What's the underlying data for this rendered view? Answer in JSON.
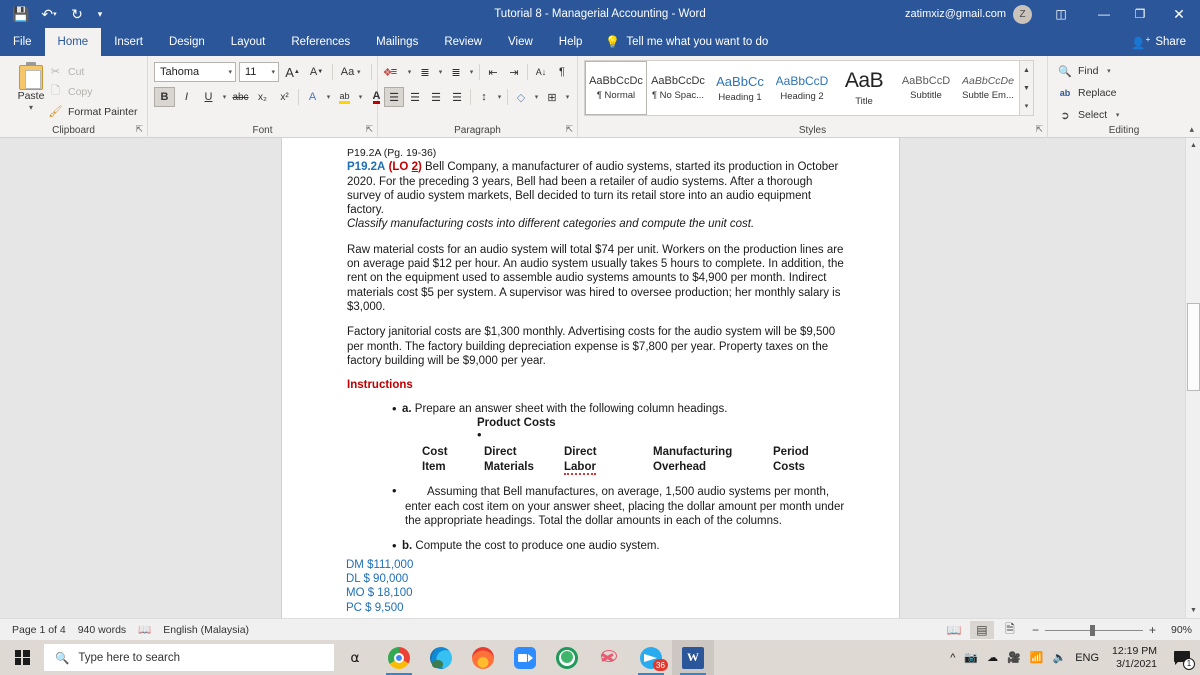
{
  "titlebar": {
    "document_title": "Tutorial 8 - Managerial Accounting  -  Word",
    "account_email": "zatimxiz@gmail.com",
    "avatar_initial": "Z",
    "quick_access": [
      {
        "name": "save",
        "glyph": "ὋE"
      },
      {
        "name": "undo",
        "glyph": "↶"
      },
      {
        "name": "redo",
        "glyph": "↻"
      },
      {
        "name": "customize",
        "glyph": "≡"
      }
    ],
    "ribbon_display_options": "☷",
    "minimize": "—",
    "restore": "❐",
    "close": "✕"
  },
  "tabs": [
    {
      "label": "File",
      "active": false
    },
    {
      "label": "Home",
      "active": true
    },
    {
      "label": "Insert",
      "active": false
    },
    {
      "label": "Design",
      "active": false
    },
    {
      "label": "Layout",
      "active": false
    },
    {
      "label": "References",
      "active": false
    },
    {
      "label": "Mailings",
      "active": false
    },
    {
      "label": "Review",
      "active": false
    },
    {
      "label": "View",
      "active": false
    },
    {
      "label": "Help",
      "active": false
    }
  ],
  "tellme": {
    "label": "Tell me what you want to do",
    "icon": "Ὂ1"
  },
  "share": {
    "label": "Share"
  },
  "ribbon": {
    "clipboard": {
      "group_label": "Clipboard",
      "paste_label": "Paste",
      "cut_label": "Cut",
      "copy_label": "Copy",
      "format_painter_label": "Format Painter"
    },
    "font": {
      "group_label": "Font",
      "font_name": "Tahoma",
      "font_size": "11",
      "grow_font": "A",
      "shrink_font": "A",
      "change_case": "Aa",
      "clear_formatting": "✐",
      "bold": "B",
      "italic": "I",
      "underline": "U",
      "strikethrough": "abc",
      "subscript": "x₂",
      "superscript": "x²",
      "text_effects": "A",
      "highlight": "ab",
      "font_color": "A"
    },
    "paragraph": {
      "group_label": "Paragraph",
      "bullets": "☰",
      "numbering": "☰",
      "multilevel": "☰",
      "decrease_indent": "⇤",
      "increase_indent": "⇥",
      "sort": "A↓",
      "show_marks": "¶",
      "align_left": "☰",
      "align_center": "☰",
      "align_right": "☰",
      "justify": "☰",
      "line_spacing": "↕",
      "shading": "■",
      "borders": "⊞"
    },
    "styles": {
      "group_label": "Styles",
      "items": [
        {
          "preview": "AaBbCcDc",
          "name": "¶ Normal",
          "kind": "normal",
          "selected": true
        },
        {
          "preview": "AaBbCcDc",
          "name": "¶ No Spac...",
          "kind": "normal",
          "selected": false
        },
        {
          "preview": "AaBbCc",
          "name": "Heading 1",
          "kind": "h1",
          "selected": false
        },
        {
          "preview": "AaBbCcD",
          "name": "Heading 2",
          "kind": "h2",
          "selected": false
        },
        {
          "preview": "AaB",
          "name": "Title",
          "kind": "title",
          "selected": false
        },
        {
          "preview": "AaBbCcD",
          "name": "Subtitle",
          "kind": "subtitle",
          "selected": false
        },
        {
          "preview": "AaBbCcDe",
          "name": "Subtle Em...",
          "kind": "subtle",
          "selected": false
        }
      ]
    },
    "editing": {
      "group_label": "Editing",
      "find_label": "Find",
      "replace_label": "Replace",
      "select_label": "Select"
    }
  },
  "document": {
    "ref_line": "P19.2A (Pg. 19-36)",
    "problem_tag": "P19.2A",
    "lo_prefix": "(LO ",
    "lo_number": "2",
    "lo_suffix": ")",
    "intro_text": " Bell Company, a manufacturer of audio systems, started its production in October 2020. For the preceding 3 years, Bell had been a retailer of audio systems. After a thorough survey of audio system markets, Bell decided to turn its retail store into an audio equipment factory.",
    "italic_line": "Classify manufacturing costs into different categories and compute the unit cost.",
    "para1": "Raw material costs for an audio system will total $74 per unit. Workers on the production lines are on average paid $12 per hour. An audio system usually takes 5 hours to complete. In addition, the rent on the equipment used to assemble audio systems amounts to $4,900 per month. Indirect materials cost $5 per system. A supervisor was hired to oversee production; her monthly salary is $3,000.",
    "para2": "Factory janitorial costs are $1,300 monthly. Advertising costs for the audio system will be $9,500 per month. The factory building depreciation expense is $7,800 per year. Property taxes on the factory building will be $9,000 per year.",
    "instructions_heading": "Instructions",
    "item_a_label": "a.",
    "item_a_text": " Prepare an answer sheet with the following column headings.",
    "product_costs_heading": "Product Costs",
    "table_headers_row1": [
      "Cost",
      "Direct",
      "Direct",
      "Manufacturing",
      "Period"
    ],
    "table_headers_row2": [
      "Item",
      "Materials",
      "Labor",
      "Overhead",
      "Costs"
    ],
    "item_assume_text": "Assuming that Bell manufactures, on average, 1,500 audio systems per month, enter each cost item on your answer sheet, placing the dollar amount per month under the appropriate headings. Total the dollar amounts in each of the columns.",
    "item_b_label": "b.",
    "item_b_text": " Compute the cost to produce one audio system.",
    "answers": [
      "DM $111,000",
      "DL $ 90,000",
      "MO $ 18,100",
      "PC $ 9,500"
    ]
  },
  "statusbar": {
    "page_info": "Page 1 of 4",
    "word_count": "940 words",
    "proofing_icon": "Ὅ6",
    "language": "English (Malaysia)",
    "views": [
      {
        "name": "read-mode",
        "glyph": "Ὅ6",
        "active": false
      },
      {
        "name": "print-layout",
        "glyph": "▤",
        "active": true
      },
      {
        "name": "web-layout",
        "glyph": "὜E",
        "active": false
      }
    ],
    "zoom_out": "−",
    "zoom_in": "+",
    "zoom_level": "90%"
  },
  "taskbar": {
    "search_placeholder": "Type here to search",
    "apps": [
      {
        "name": "chrome",
        "badge": null,
        "active": false,
        "running": true
      },
      {
        "name": "edge",
        "badge": null,
        "active": false,
        "running": false
      },
      {
        "name": "firefox",
        "badge": null,
        "active": false,
        "running": false
      },
      {
        "name": "zoom",
        "badge": null,
        "active": false,
        "running": false
      },
      {
        "name": "app-green",
        "badge": null,
        "active": false,
        "running": false
      },
      {
        "name": "snipping-tool",
        "badge": null,
        "active": false,
        "running": false
      },
      {
        "name": "telegram",
        "badge": "36",
        "active": false,
        "running": true
      },
      {
        "name": "word",
        "badge": null,
        "active": true,
        "running": true
      }
    ],
    "tray_icons": [
      "^",
      "὏7",
      "☁",
      "Ἲ5",
      "὏6"
    ],
    "language": "ENG",
    "time": "12:19 PM",
    "date": "3/1/2021",
    "notification_count": "1"
  }
}
